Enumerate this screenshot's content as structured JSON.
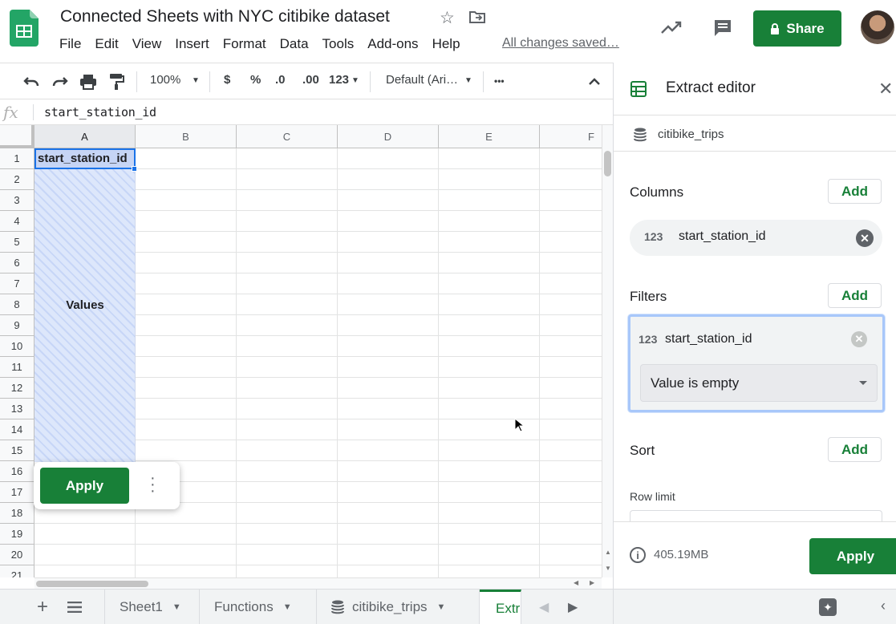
{
  "doc": {
    "title": "Connected Sheets with NYC citibike dataset",
    "saved": "All changes saved…"
  },
  "menu": [
    "File",
    "Edit",
    "View",
    "Insert",
    "Format",
    "Data",
    "Tools",
    "Add-ons",
    "Help"
  ],
  "header": {
    "share": "Share"
  },
  "toolbar": {
    "zoom": "100%",
    "currency": "$",
    "percent": "%",
    "dec_less": ".0",
    "dec_more": ".00",
    "num_format": "123",
    "font": "Default (Ari…",
    "more": "•••"
  },
  "formula": {
    "fx": "fx",
    "value": "start_station_id"
  },
  "columns": [
    "A",
    "B",
    "C",
    "D",
    "E",
    "F"
  ],
  "rows": [
    "1",
    "2",
    "3",
    "4",
    "5",
    "6",
    "7",
    "8",
    "9",
    "10",
    "11",
    "12",
    "13",
    "14",
    "15",
    "16",
    "17",
    "18",
    "19",
    "20",
    "21"
  ],
  "cells": {
    "a1": "start_station_id",
    "values_label": "Values"
  },
  "popup": {
    "apply": "Apply"
  },
  "tabs": {
    "sheet1": "Sheet1",
    "functions": "Functions",
    "citibike": "citibike_trips",
    "active": "Extr"
  },
  "panel": {
    "title": "Extract editor",
    "source": "citibike_trips",
    "columns_label": "Columns",
    "add": "Add",
    "col_chip_type": "123",
    "col_chip": "start_station_id",
    "filters_label": "Filters",
    "filter_type": "123",
    "filter_field": "start_station_id",
    "filter_condition": "Value is empty",
    "sort_label": "Sort",
    "row_limit_label": "Row limit",
    "size": "405.19MB",
    "apply": "Apply"
  },
  "colors": {
    "green": "#188038",
    "blue": "#1a73e8"
  }
}
